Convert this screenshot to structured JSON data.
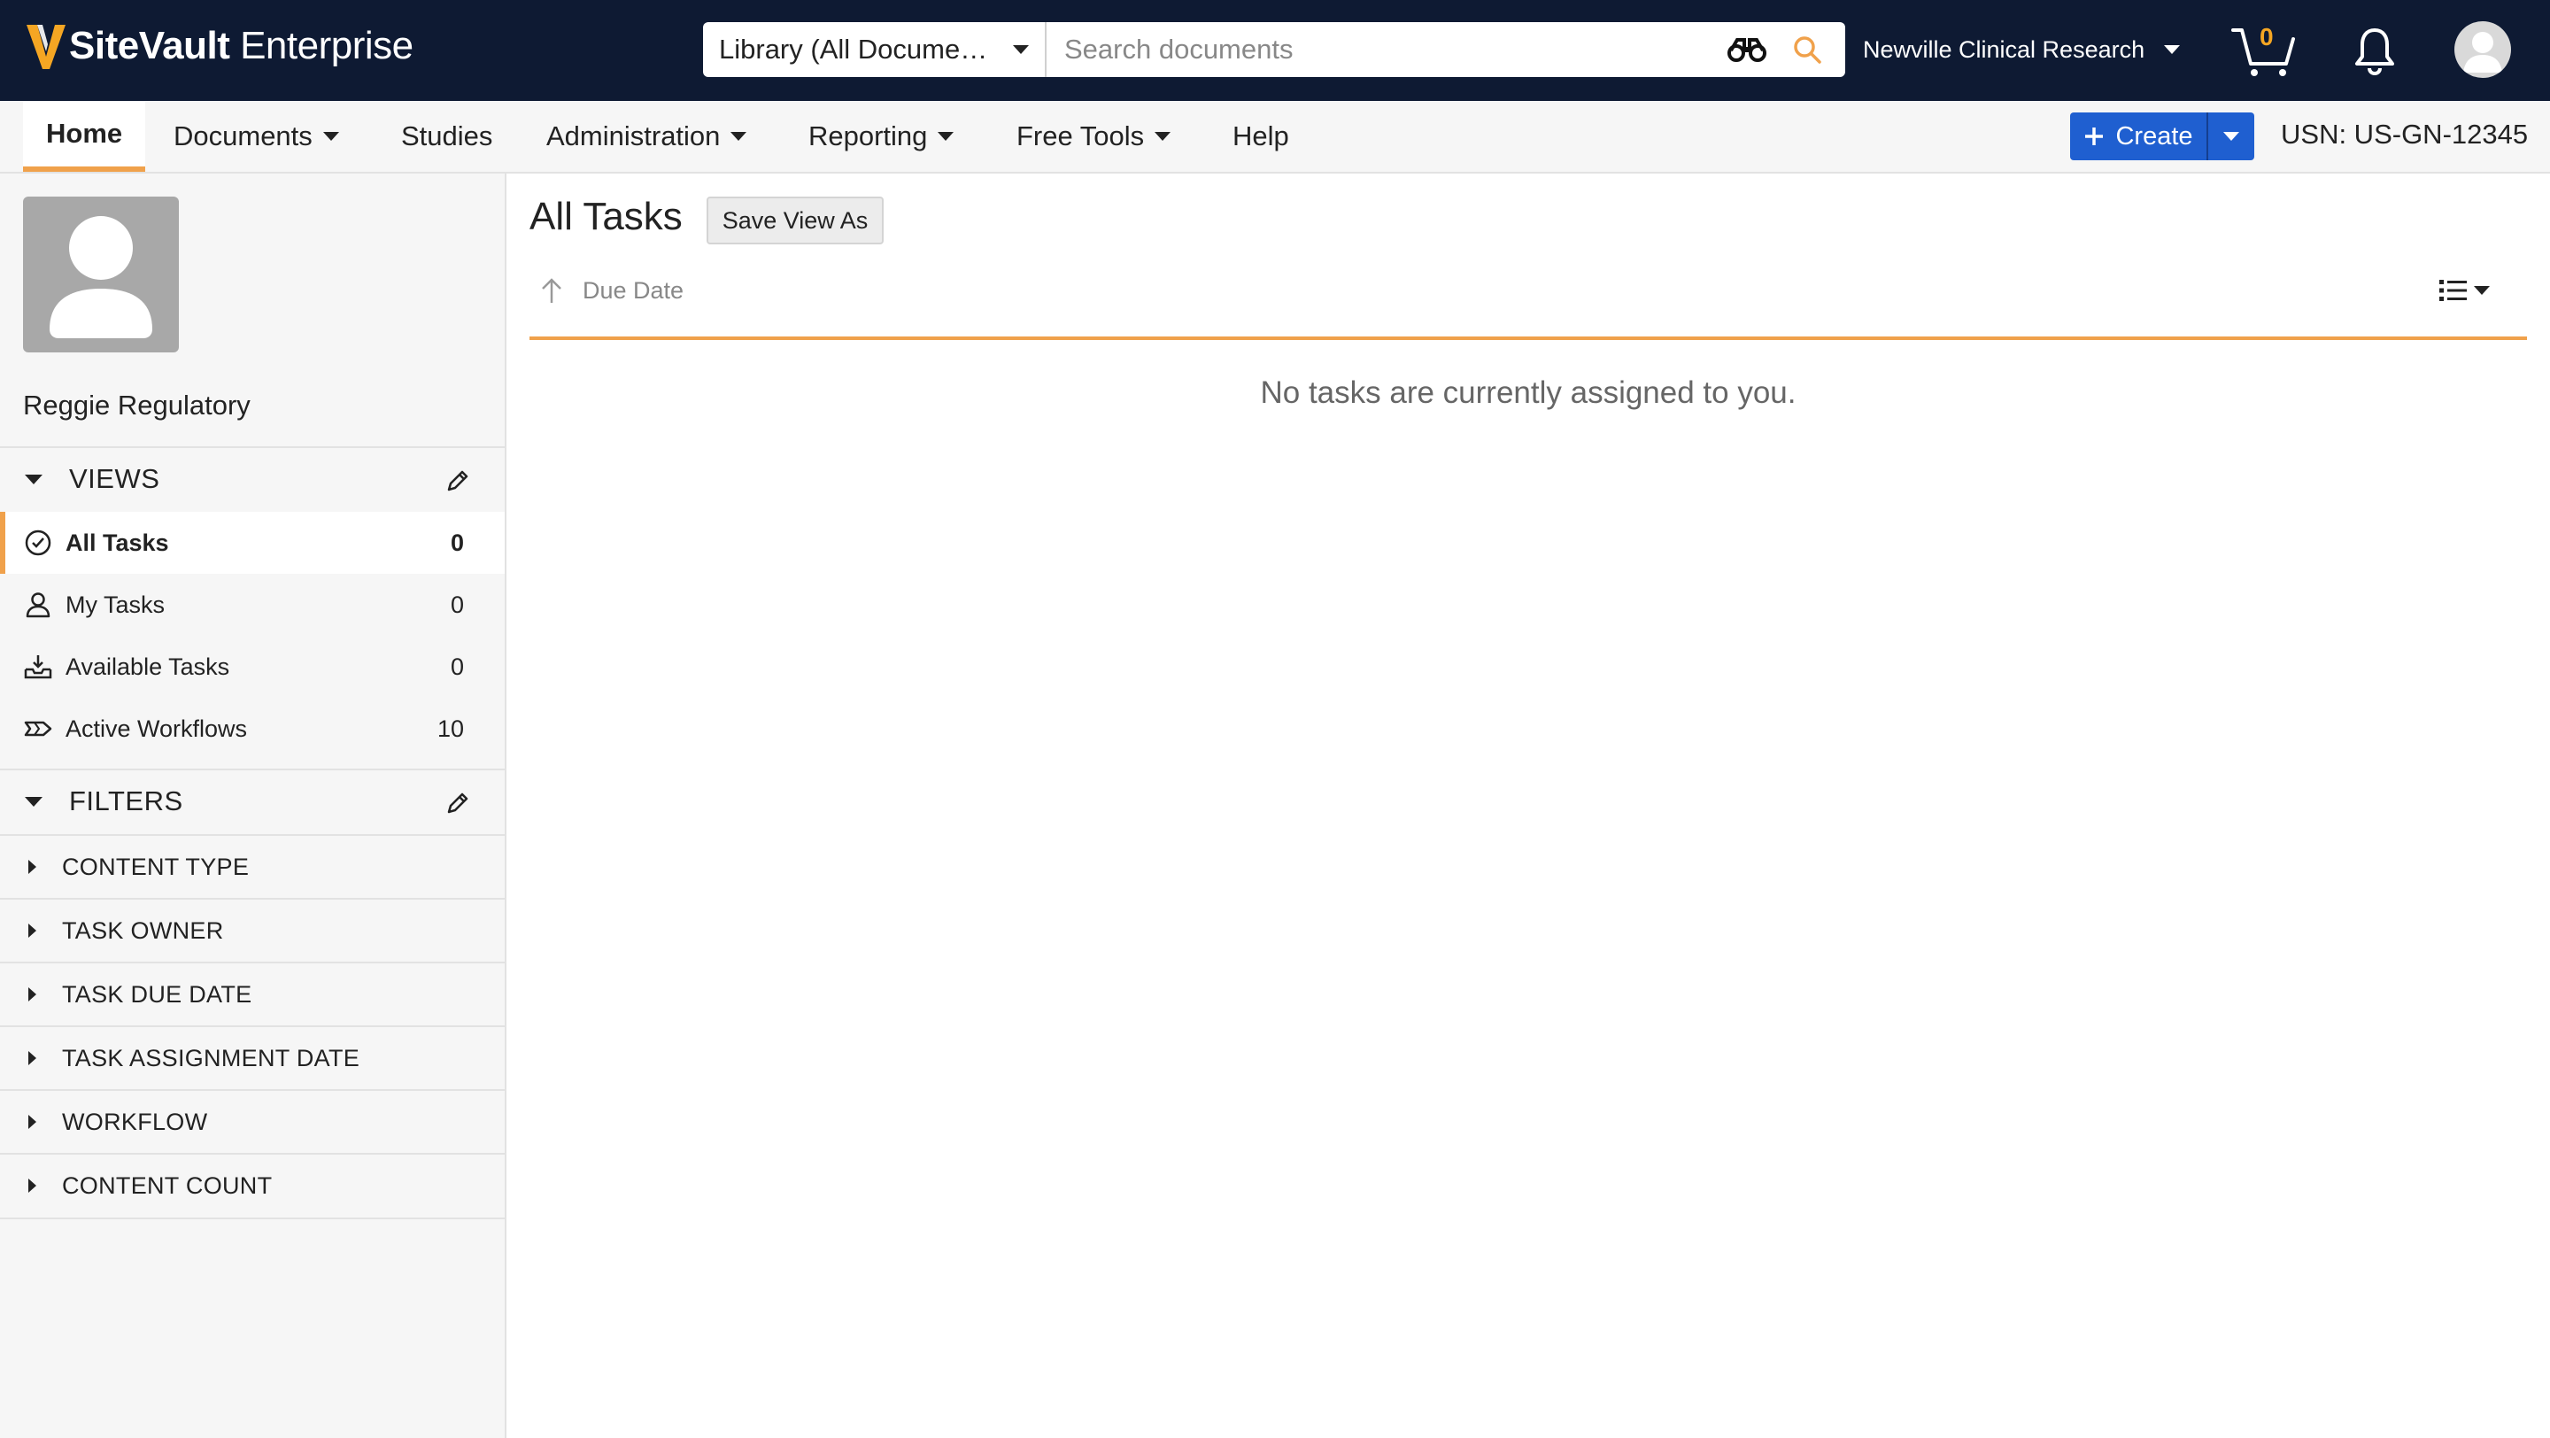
{
  "app": {
    "brand_bold": "SiteVault",
    "brand_light": " Enterprise"
  },
  "search": {
    "scope_label": "Library (All Documents)",
    "placeholder": "Search documents"
  },
  "org": {
    "name": "Newville Clinical Research"
  },
  "cart": {
    "count": "0"
  },
  "nav": {
    "home": "Home",
    "documents": "Documents",
    "studies": "Studies",
    "administration": "Administration",
    "reporting": "Reporting",
    "free_tools": "Free Tools",
    "help": "Help",
    "create": "Create",
    "usn": "USN: US-GN-12345"
  },
  "profile": {
    "name": "Reggie Regulatory"
  },
  "views": {
    "heading": "VIEWS",
    "items": [
      {
        "label": "All Tasks",
        "count": "0",
        "icon": "check-circle-icon"
      },
      {
        "label": "My Tasks",
        "count": "0",
        "icon": "person-icon"
      },
      {
        "label": "Available Tasks",
        "count": "0",
        "icon": "inbox-download-icon"
      },
      {
        "label": "Active Workflows",
        "count": "10",
        "icon": "workflow-icon"
      }
    ]
  },
  "filters": {
    "heading": "FILTERS",
    "items": [
      "CONTENT TYPE",
      "TASK OWNER",
      "TASK DUE DATE",
      "TASK ASSIGNMENT DATE",
      "WORKFLOW",
      "CONTENT COUNT"
    ]
  },
  "main": {
    "title": "All Tasks",
    "save_view": "Save View As",
    "sort_label": "Due Date",
    "empty_message": "No tasks are currently assigned to you."
  },
  "colors": {
    "topbar": "#0e1a33",
    "accent_orange": "#f0a14b",
    "create_blue": "#1f5fd0",
    "cart_count": "#f5a623"
  }
}
